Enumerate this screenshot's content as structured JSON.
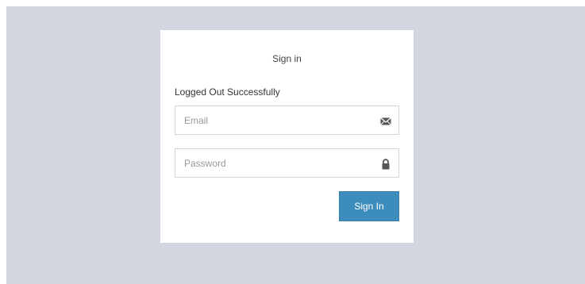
{
  "login": {
    "title": "Sign in",
    "status_message": "Logged Out Successfully",
    "email": {
      "value": "",
      "placeholder": "Email",
      "icon": "envelope-icon"
    },
    "password": {
      "value": "",
      "placeholder": "Password",
      "icon": "lock-icon"
    },
    "submit_label": "Sign In"
  },
  "colors": {
    "backdrop": "#d2d6de",
    "card": "#ffffff",
    "primary_button": "#3c8dbc",
    "icon": "#555555"
  }
}
